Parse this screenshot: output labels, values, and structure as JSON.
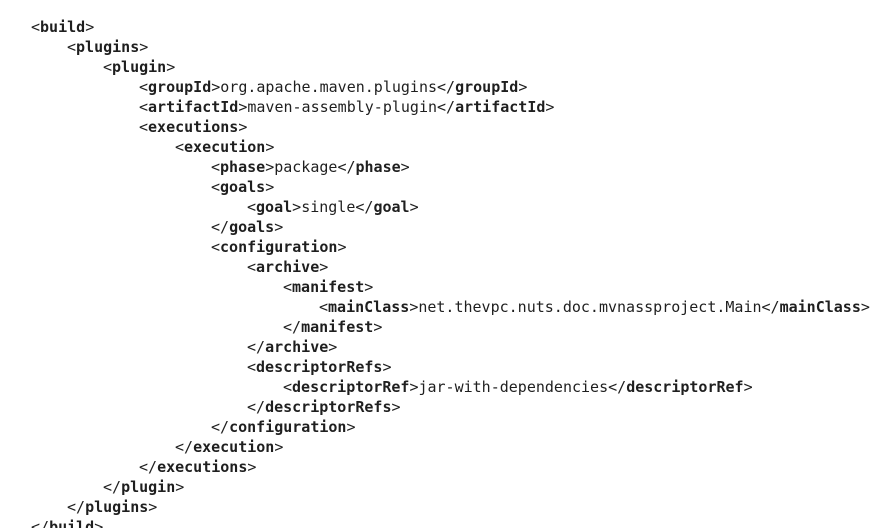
{
  "editor": {
    "lines": [
      {
        "open_tag": "build"
      },
      {
        "open_tag": "plugins"
      },
      {
        "open_tag": "plugin"
      },
      {
        "tag": "groupId",
        "value": "org.apache.maven.plugins"
      },
      {
        "tag": "artifactId",
        "value": "maven-assembly-plugin"
      },
      {
        "open_tag": "executions"
      },
      {
        "open_tag": "execution"
      },
      {
        "tag": "phase",
        "value": "package"
      },
      {
        "open_tag": "goals"
      },
      {
        "tag": "goal",
        "value": "single"
      },
      {
        "close_tag": "goals"
      },
      {
        "open_tag": "configuration"
      },
      {
        "open_tag": "archive"
      },
      {
        "open_tag": "manifest"
      },
      {
        "tag": "mainClass",
        "value": "net.thevpc.nuts.doc.mvnassproject.Main"
      },
      {
        "close_tag": "manifest"
      },
      {
        "close_tag": "archive"
      },
      {
        "open_tag": "descriptorRefs"
      },
      {
        "tag": "descriptorRef",
        "value": "jar-with-dependencies"
      },
      {
        "close_tag": "descriptorRefs"
      },
      {
        "close_tag": "configuration"
      },
      {
        "close_tag": "execution"
      },
      {
        "close_tag": "executions"
      },
      {
        "close_tag": "plugin"
      },
      {
        "close_tag": "plugins"
      },
      {
        "close_tag": "build"
      }
    ]
  }
}
